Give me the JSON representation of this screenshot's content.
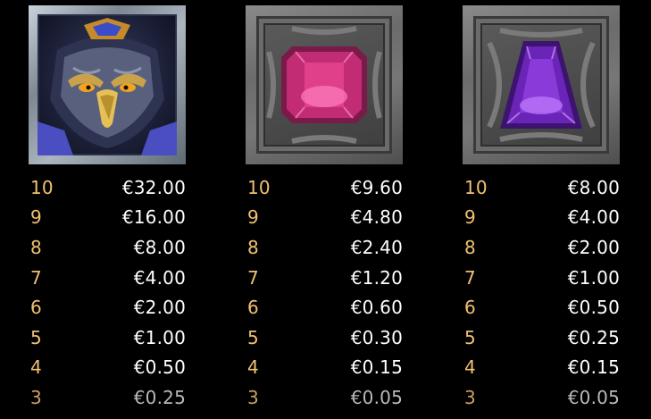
{
  "paytable": [
    {
      "symbol_icon": "owl-knight-icon",
      "rows": [
        {
          "count": "10",
          "payout": "€32.00"
        },
        {
          "count": "9",
          "payout": "€16.00"
        },
        {
          "count": "8",
          "payout": "€8.00"
        },
        {
          "count": "7",
          "payout": "€4.00"
        },
        {
          "count": "6",
          "payout": "€2.00"
        },
        {
          "count": "5",
          "payout": "€1.00"
        },
        {
          "count": "4",
          "payout": "€0.50"
        },
        {
          "count": "3",
          "payout": "€0.25"
        }
      ]
    },
    {
      "symbol_icon": "pink-gem-icon",
      "rows": [
        {
          "count": "10",
          "payout": "€9.60"
        },
        {
          "count": "9",
          "payout": "€4.80"
        },
        {
          "count": "8",
          "payout": "€2.40"
        },
        {
          "count": "7",
          "payout": "€1.20"
        },
        {
          "count": "6",
          "payout": "€0.60"
        },
        {
          "count": "5",
          "payout": "€0.30"
        },
        {
          "count": "4",
          "payout": "€0.15"
        },
        {
          "count": "3",
          "payout": "€0.05"
        }
      ]
    },
    {
      "symbol_icon": "purple-gem-icon",
      "rows": [
        {
          "count": "10",
          "payout": "€8.00"
        },
        {
          "count": "9",
          "payout": "€4.00"
        },
        {
          "count": "8",
          "payout": "€2.00"
        },
        {
          "count": "7",
          "payout": "€1.00"
        },
        {
          "count": "6",
          "payout": "€0.50"
        },
        {
          "count": "5",
          "payout": "€0.25"
        },
        {
          "count": "4",
          "payout": "€0.15"
        },
        {
          "count": "3",
          "payout": "€0.05"
        }
      ]
    }
  ],
  "colors": {
    "background": "#000000",
    "count_text": "#f0c071",
    "payout_text": "#ffffff",
    "pink_gem": "#e0408a",
    "purple_gem": "#8a3ad8"
  }
}
